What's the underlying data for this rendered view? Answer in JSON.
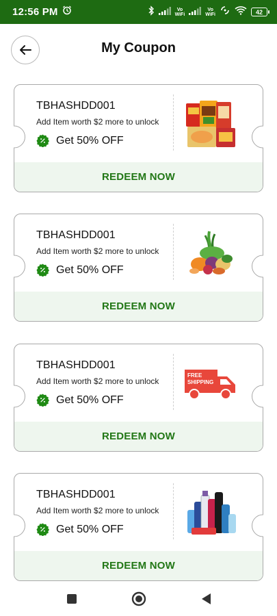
{
  "status_bar": {
    "time": "12:56 PM",
    "alarm_icon": "alarm-icon",
    "bluetooth_icon": "bluetooth-icon",
    "signal_1_label": "Vo\nWiFi",
    "signal_2_label": "Vo\nWiFi",
    "battery": "42"
  },
  "header": {
    "title": "My Coupon",
    "back_icon": "arrow-left-icon"
  },
  "colors": {
    "status_bar_bg": "#1e6b12",
    "accent_green": "#227716",
    "redeem_bg": "#eef6ee",
    "badge_green": "#1f8a14",
    "card_border": "#a9a9a9"
  },
  "coupons": [
    {
      "code": "TBHASHDD001",
      "condition": "Add Item worth $2 more to unlock",
      "offer": "Get 50% OFF",
      "redeem_label": "REDEEM NOW",
      "image": "snacks-image"
    },
    {
      "code": "TBHASHDD001",
      "condition": "Add Item worth $2 more to unlock",
      "offer": "Get 50% OFF",
      "redeem_label": "REDEEM NOW",
      "image": "vegetables-image"
    },
    {
      "code": "TBHASHDD001",
      "condition": "Add Item worth $2 more to unlock",
      "offer": "Get 50% OFF",
      "redeem_label": "REDEEM NOW",
      "image": "free-shipping-truck-image",
      "image_text": "FREE SHIPPING"
    },
    {
      "code": "TBHASHDD001",
      "condition": "Add Item worth $2 more to unlock",
      "offer": "Get 50% OFF",
      "redeem_label": "REDEEM NOW",
      "image": "personal-care-products-image"
    }
  ],
  "nav_bar": {
    "recents_icon": "square-icon",
    "home_icon": "circle-home-icon",
    "back_icon": "triangle-back-icon"
  }
}
